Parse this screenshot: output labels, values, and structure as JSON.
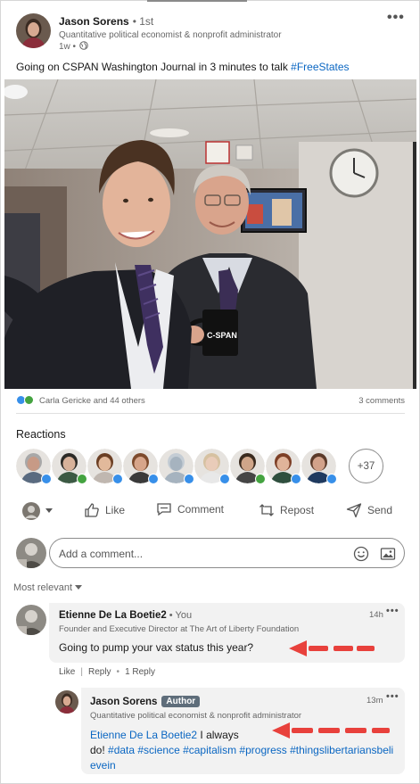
{
  "post": {
    "author_name": "Jason Sorens",
    "degree": "• 1st",
    "headline": "Quantitative political economist & nonprofit administrator",
    "time": "1w •",
    "text_main": "Going on CSPAN Washington Journal in 3 minutes to talk ",
    "text_hashtag": "#FreeStates",
    "more_icon": "ellipsis-icon",
    "globe_icon": "globe-icon"
  },
  "photo": {
    "mug_text": "C-SPAN"
  },
  "social": {
    "reactors_text": "Carla Gericke and 44 others",
    "comments_count": "3 comments",
    "reaction_icons": [
      "like-icon",
      "celebrate-icon"
    ]
  },
  "reactions": {
    "title": "Reactions",
    "more_count": "+37",
    "people": [
      {
        "badge": "like",
        "skin": "#c79a86",
        "hair": "#a8a8a8",
        "shirt": "#5a6b80"
      },
      {
        "badge": "celebrate",
        "skin": "#d8b29a",
        "hair": "#2c2a26",
        "shirt": "#3c5a44"
      },
      {
        "badge": "like",
        "skin": "#e2b99b",
        "hair": "#6b3f24",
        "shirt": "#c0b7b0"
      },
      {
        "badge": "like",
        "skin": "#d7a58a",
        "hair": "#7d4a2c",
        "shirt": "#3a3a3a"
      },
      {
        "badge": "like",
        "skin": "#a6b3bf",
        "hair": "#c4ccd4",
        "shirt": "#a6b3bf"
      },
      {
        "badge": "like",
        "skin": "#e9ccb9",
        "hair": "#d6c1a1",
        "shirt": "#e8e8e8"
      },
      {
        "badge": "celebrate",
        "skin": "#cfa589",
        "hair": "#3a2a1e",
        "shirt": "#454545"
      },
      {
        "badge": "like",
        "skin": "#e0b49a",
        "hair": "#7d3f26",
        "shirt": "#2f4f3e"
      },
      {
        "badge": "like",
        "skin": "#d2a28a",
        "hair": "#5b3a29",
        "shirt": "#1f3a5f"
      }
    ]
  },
  "actions": {
    "like": "Like",
    "comment": "Comment",
    "repost": "Repost",
    "send": "Send"
  },
  "comment_input": {
    "placeholder": "Add a comment..."
  },
  "sort": {
    "label": "Most relevant"
  },
  "comments": [
    {
      "name": "Etienne De La Boetie2",
      "you": "• You",
      "headline": "Founder and Executive Director at The Art of Liberty Foundation",
      "time": "14h",
      "text": "Going to pump your vax status this year?",
      "like": "Like",
      "reply": "Reply",
      "replies": "1 Reply"
    },
    {
      "name": "Jason Sorens",
      "badge": "Author",
      "headline": "Quantitative political economist & nonprofit administrator",
      "time": "13m",
      "mention": "Etienne De La Boetie2",
      "text_after_mention": " I always",
      "line2_prefix": "do! ",
      "hashtags_line2": "#data #science #capitalism #progress #thingslibertariansbeli",
      "hashtags_line3": "evein"
    }
  ],
  "colors": {
    "link": "#0a66c2",
    "bubble": "#f2f2f2",
    "arrow": "#e8413c",
    "author_badge": "#5e6d7a"
  }
}
